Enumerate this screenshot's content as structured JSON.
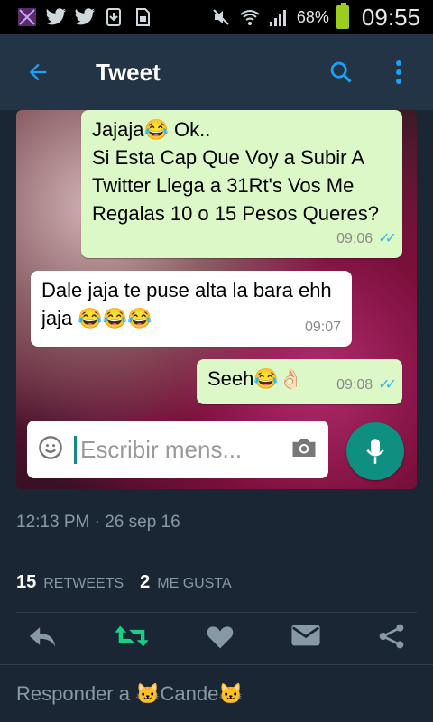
{
  "status_bar": {
    "battery": "68%",
    "time": "09:55"
  },
  "app_bar": {
    "title": "Tweet",
    "icons": [
      "back-arrow-icon",
      "search-icon",
      "more-vert-icon"
    ],
    "accent": "#1da1f2"
  },
  "media": {
    "messages": [
      {
        "text": "Jajaja😂 Ok..\nSi Esta Cap Que Voy a Subir A Twitter Llega a 31Rt's Vos Me Regalas 10 o 15 Pesos Queres?",
        "time": "09:06",
        "dir": "out"
      },
      {
        "text": "Dale jaja te puse alta la bara ehh jaja 😂😂😂",
        "time": "09:07",
        "dir": "in"
      },
      {
        "text": "Seeh😂👌🏻",
        "time": "09:08",
        "dir": "out"
      }
    ],
    "composer_placeholder": "Escribir mens...",
    "icons": [
      "emoji-icon",
      "camera-icon",
      "mic-icon"
    ]
  },
  "tweet_meta": {
    "timestamp": "12:13 PM · 26 sep 16",
    "retweets_count": "15",
    "retweets_label": "RETWEETS",
    "likes_count": "2",
    "likes_label": "ME GUSTA"
  },
  "actions": [
    "reply-icon",
    "retweet-icon",
    "like-icon",
    "message-icon",
    "share-icon"
  ],
  "reply_bar": {
    "text": "Responder a 🐱Cande🐱"
  }
}
